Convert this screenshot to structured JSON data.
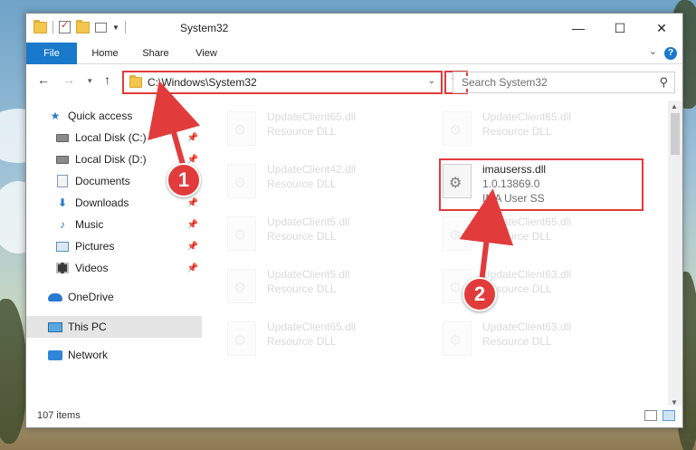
{
  "window": {
    "title": "System32"
  },
  "win_controls": {
    "minimize": "—",
    "maximize": "☐",
    "close": "✕"
  },
  "ribbon": {
    "tabs": [
      "File",
      "Home",
      "Share",
      "View"
    ],
    "help": "?"
  },
  "nav": {
    "back": "←",
    "forward": "→",
    "recent": "▾",
    "up": "↑"
  },
  "address": {
    "path": "C:\\Windows\\System32",
    "dropdown": "⌄",
    "refresh": "↻"
  },
  "search": {
    "placeholder": "Search System32",
    "icon": "⚲"
  },
  "sidebar": {
    "items": [
      {
        "label": "Quick access",
        "icon": "star-icon",
        "pinned": false
      },
      {
        "label": "Local Disk (C:)",
        "icon": "drive-icon",
        "pinned": true
      },
      {
        "label": "Local Disk (D:)",
        "icon": "drive-icon",
        "pinned": true
      },
      {
        "label": "Documents",
        "icon": "documents-icon",
        "pinned": true
      },
      {
        "label": "Downloads",
        "icon": "download-icon",
        "pinned": true
      },
      {
        "label": "Music",
        "icon": "music-icon",
        "pinned": true
      },
      {
        "label": "Pictures",
        "icon": "pictures-icon",
        "pinned": true
      },
      {
        "label": "Videos",
        "icon": "videos-icon",
        "pinned": true
      },
      {
        "label": "OneDrive",
        "icon": "cloud-icon",
        "pinned": false
      },
      {
        "label": "This PC",
        "icon": "computer-icon",
        "pinned": false,
        "selected": true
      },
      {
        "label": "Network",
        "icon": "network-icon",
        "pinned": false
      }
    ],
    "pin_glyph": "📌"
  },
  "files": [
    {
      "name": "UpdateClient65.dll",
      "sub": "Resource DLL"
    },
    {
      "name": "UpdateClient65.dll",
      "sub": "Resource DLL"
    },
    {
      "name": "UpdateClient42.dll",
      "sub": "Resource DLL"
    },
    {
      "name": "imauserss.dll",
      "version": "1.0.13869.0",
      "desc": "IMA User SS",
      "highlight": true
    },
    {
      "name": "UpdateClient5.dll",
      "sub": "Resource DLL"
    },
    {
      "name": "UpdateClient65.dll",
      "sub": "Resource DLL"
    },
    {
      "name": "UpdateClient5.dll",
      "sub": "Resource DLL"
    },
    {
      "name": "UpdateClient63.dll",
      "sub": "Resource DLL"
    },
    {
      "name": "UpdateClient65.dll",
      "sub": "Resource DLL"
    },
    {
      "name": "UpdateClient63.dll",
      "sub": "Resource DLL"
    }
  ],
  "status": {
    "items_count": "107 items"
  },
  "callouts": {
    "one": "1",
    "two": "2"
  },
  "colors": {
    "accent": "#1979ca",
    "annotation_red": "#e23b3b",
    "selected_bg": "#e5e5e5"
  }
}
